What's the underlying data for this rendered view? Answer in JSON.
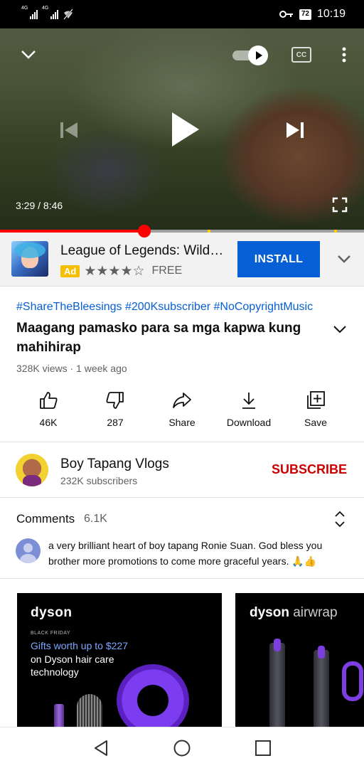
{
  "status_bar": {
    "signal1_label": "4G",
    "signal2_label": "4G",
    "battery": "72",
    "time": "10:19"
  },
  "player": {
    "current_time": "3:29",
    "duration": "8:46",
    "time_text": "3:29 / 8:46",
    "cc_label": "CC",
    "progress_fraction": 0.397,
    "autoplay_on": true
  },
  "ad": {
    "title": "League of Legends: Wild…",
    "badge": "Ad",
    "rating": 4,
    "stars_text": "★★★★☆",
    "price": "FREE",
    "install_label": "INSTALL"
  },
  "video": {
    "hashtags": "#ShareTheBleesings #200Ksubscriber #NoCopyrightMusic",
    "title": "Maagang pamasko para sa mga kapwa kung mahihirap",
    "meta": "328K views · 1 week ago"
  },
  "actions": [
    {
      "label": "46K",
      "icon": "like-icon"
    },
    {
      "label": "287",
      "icon": "dislike-icon"
    },
    {
      "label": "Share",
      "icon": "share-icon"
    },
    {
      "label": "Download",
      "icon": "download-icon"
    },
    {
      "label": "Save",
      "icon": "save-to-playlist-icon"
    }
  ],
  "channel": {
    "name": "Boy Tapang Vlogs",
    "subscribers": "232K subscribers",
    "subscribe_label": "SUBSCRIBE"
  },
  "comments": {
    "label": "Comments",
    "count": "6.1K",
    "top_comment": "a very brilliant heart of boy tapang Ronie Suan. God bless you brother more promotions to come more graceful years. 🙏👍"
  },
  "promo_cards": [
    {
      "brand": "dyson",
      "eyebrow": "BLACK FRIDAY",
      "headline": "Gifts worth up to $227",
      "body": "on Dyson hair care technology"
    },
    {
      "brand": "dyson",
      "product": "airwrap"
    }
  ],
  "colors": {
    "accent_blue": "#065fd4",
    "subscribe_red": "#cc0000",
    "progress_red": "#ff0000",
    "ad_badge": "#f6be00"
  }
}
